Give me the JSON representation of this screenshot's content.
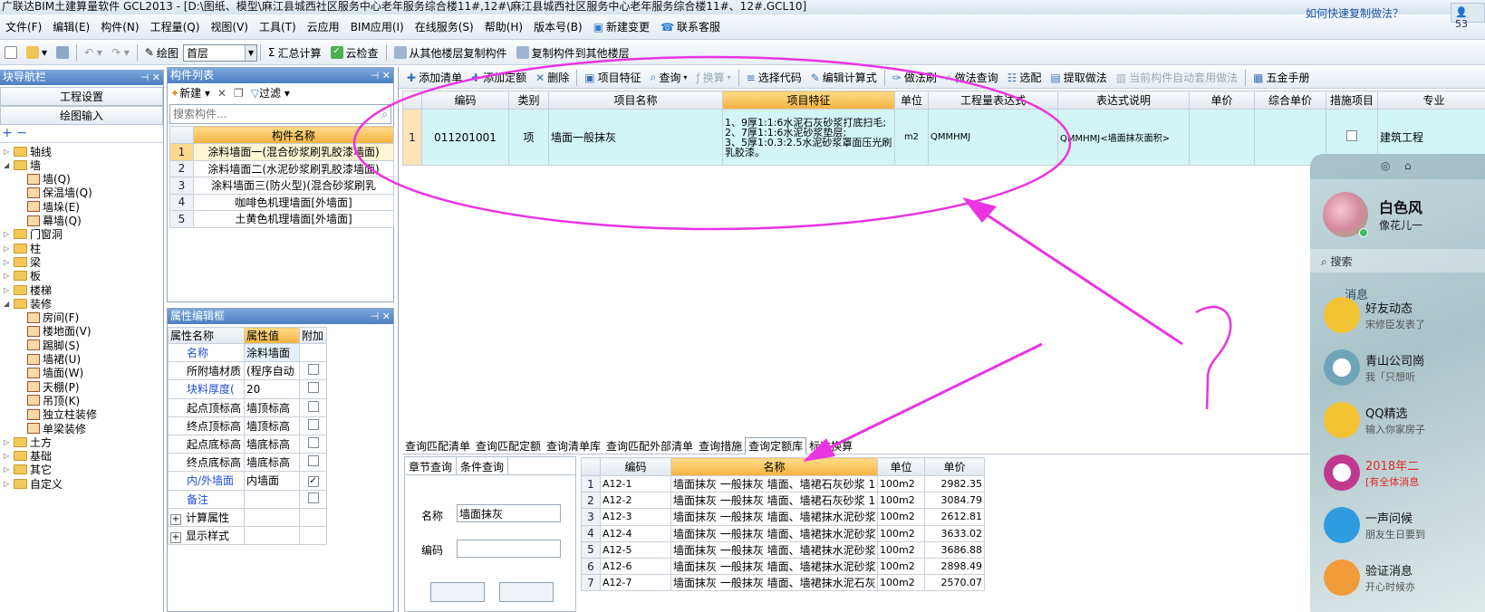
{
  "titlebar": {
    "text": "广联达BIM土建算量软件 GCL2013 - [D:\\图纸、模型\\麻江县城西社区服务中心老年服务综合楼11#,12#\\麻江县城西社区服务中心老年服务综合楼11#、12#.GCL10]"
  },
  "menubar": {
    "items": [
      "文件(F)",
      "编辑(E)",
      "构件(N)",
      "工程量(Q)",
      "视图(V)",
      "工具(T)",
      "云应用",
      "BIM应用(I)",
      "在线服务(S)",
      "帮助(H)",
      "版本号(B)"
    ],
    "new_change": "新建变更",
    "support": "联系客服",
    "help_link": "如何快速复制做法？",
    "right_badge": "53"
  },
  "toolbar": {
    "draw": "绘图",
    "floor": "首层",
    "sum": "汇总计算",
    "cloud_check": "云检查",
    "copy_from": "从其他楼层复制构件",
    "copy_to": "复制构件到其他楼层"
  },
  "nav": {
    "title": "块导航栏",
    "btn1": "工程设置",
    "btn2": "绘图输入",
    "tree": [
      {
        "label": "轴线",
        "indent": 0,
        "type": "folder",
        "exp": "▷"
      },
      {
        "label": "墙",
        "indent": 0,
        "type": "folder",
        "exp": "◢"
      },
      {
        "label": "墙(Q)",
        "indent": 1,
        "type": "leaf"
      },
      {
        "label": "保温墙(Q)",
        "indent": 1,
        "type": "leaf"
      },
      {
        "label": "墙垛(E)",
        "indent": 1,
        "type": "leaf"
      },
      {
        "label": "幕墙(Q)",
        "indent": 1,
        "type": "leaf"
      },
      {
        "label": "门窗洞",
        "indent": 0,
        "type": "folder",
        "exp": "▷"
      },
      {
        "label": "柱",
        "indent": 0,
        "type": "folder",
        "exp": "▷"
      },
      {
        "label": "梁",
        "indent": 0,
        "type": "folder",
        "exp": "▷"
      },
      {
        "label": "板",
        "indent": 0,
        "type": "folder",
        "exp": "▷"
      },
      {
        "label": "楼梯",
        "indent": 0,
        "type": "folder",
        "exp": "▷"
      },
      {
        "label": "装修",
        "indent": 0,
        "type": "folder",
        "exp": "◢"
      },
      {
        "label": "房间(F)",
        "indent": 1,
        "type": "leaf"
      },
      {
        "label": "楼地面(V)",
        "indent": 1,
        "type": "leaf"
      },
      {
        "label": "踢脚(S)",
        "indent": 1,
        "type": "leaf"
      },
      {
        "label": "墙裙(U)",
        "indent": 1,
        "type": "leaf"
      },
      {
        "label": "墙面(W)",
        "indent": 1,
        "type": "leaf"
      },
      {
        "label": "天棚(P)",
        "indent": 1,
        "type": "leaf"
      },
      {
        "label": "吊顶(K)",
        "indent": 1,
        "type": "leaf"
      },
      {
        "label": "独立柱装修",
        "indent": 1,
        "type": "leaf"
      },
      {
        "label": "单梁装修",
        "indent": 1,
        "type": "leaf"
      },
      {
        "label": "土方",
        "indent": 0,
        "type": "folder",
        "exp": "▷"
      },
      {
        "label": "基础",
        "indent": 0,
        "type": "folder",
        "exp": "▷"
      },
      {
        "label": "其它",
        "indent": 0,
        "type": "folder",
        "exp": "▷"
      },
      {
        "label": "自定义",
        "indent": 0,
        "type": "folder",
        "exp": "▷"
      }
    ]
  },
  "comp_list": {
    "title": "构件列表",
    "new": "新建",
    "filter": "过滤",
    "search_placeholder": "搜索构件...",
    "col_header": "构件名称",
    "rows": [
      "涂料墙面一(混合砂浆刷乳胶漆墙面)",
      "涂料墙面二(水泥砂浆刷乳胶漆墙面)",
      "涂料墙面三(防火型)(混合砂浆刷乳",
      "咖啡色机理墙面[外墙面]",
      "土黄色机理墙面[外墙面]"
    ]
  },
  "prop": {
    "title": "属性编辑框",
    "headers": [
      "属性名称",
      "属性值",
      "附加"
    ],
    "rows": [
      {
        "name": "名称",
        "value": "涂料墙面",
        "blue": true,
        "check": null
      },
      {
        "name": "所附墙材质",
        "value": "(程序自动",
        "blue": false,
        "check": false
      },
      {
        "name": "块料厚度(",
        "value": "20",
        "blue": true,
        "check": false
      },
      {
        "name": "起点顶标高",
        "value": "墙顶标高",
        "blue": false,
        "check": false
      },
      {
        "name": "终点顶标高",
        "value": "墙顶标高",
        "blue": false,
        "check": false
      },
      {
        "name": "起点底标高",
        "value": "墙底标高",
        "blue": false,
        "check": false
      },
      {
        "name": "终点底标高",
        "value": "墙底标高",
        "blue": false,
        "check": false
      },
      {
        "name": "内/外墙面",
        "value": "内墙面",
        "blue": true,
        "check": true
      },
      {
        "name": "备注",
        "value": "",
        "blue": true,
        "check": false
      },
      {
        "name": "计算属性",
        "value": "",
        "blue": false,
        "check": null,
        "expand": "+"
      },
      {
        "name": "显示样式",
        "value": "",
        "blue": false,
        "check": null,
        "expand": "+"
      }
    ]
  },
  "main_toolbar": {
    "items": [
      "添加清单",
      "添加定额",
      "删除",
      "项目特征",
      "查询",
      "换算",
      "选择代码",
      "编辑计算式",
      "做法刷",
      "做法查询",
      "选配",
      "提取做法",
      "当前构件自动套用做法",
      "五金手册"
    ]
  },
  "main_grid": {
    "headers": [
      "编码",
      "类别",
      "项目名称",
      "项目特征",
      "单位",
      "工程量表达式",
      "表达式说明",
      "单价",
      "综合单价",
      "措施项目",
      "专业"
    ],
    "row": {
      "num": "1",
      "code": "011201001",
      "type": "项",
      "name": "墙面一般抹灰",
      "feature": "1、9厚1:1:6水泥石灰砂浆打底扫毛;\n2、7厚1:1:6水泥砂浆垫层;\n3、5厚1:0.3:2.5水泥砂浆罩面压光刷乳胶漆。",
      "unit": "m2",
      "expr": "QMMHMJ",
      "expr_desc": "QMMHMJ<墙面抹灰面积>",
      "price": "",
      "comp_price": "",
      "measure": false,
      "major": "建筑工程"
    }
  },
  "bottom": {
    "tabs": [
      "查询匹配清单",
      "查询匹配定额",
      "查询清单库",
      "查询匹配外部清单",
      "查询措施",
      "查询定额库",
      "标准换算"
    ],
    "active_tab": 5,
    "sub_tabs": [
      "章节查询",
      "条件查询"
    ],
    "name_label": "名称",
    "name_value": "墙面抹灰",
    "code_label": "编码",
    "code_value": "",
    "grid_headers": [
      "编码",
      "名称",
      "单位",
      "单价"
    ],
    "rows": [
      {
        "n": "1",
        "code": "A12-1",
        "name": "墙面抹灰 一般抹灰 墙面、墙裙石灰砂浆 1",
        "unit": "100m2",
        "price": "2982.35"
      },
      {
        "n": "2",
        "code": "A12-2",
        "name": "墙面抹灰 一般抹灰 墙面、墙裙石灰砂浆 1",
        "unit": "100m2",
        "price": "3084.79"
      },
      {
        "n": "3",
        "code": "A12-3",
        "name": "墙面抹灰 一般抹灰 墙面、墙裙抹水泥砂浆",
        "unit": "100m2",
        "price": "2612.81"
      },
      {
        "n": "4",
        "code": "A12-4",
        "name": "墙面抹灰 一般抹灰 墙面、墙裙抹水泥砂浆",
        "unit": "100m2",
        "price": "3633.02"
      },
      {
        "n": "5",
        "code": "A12-5",
        "name": "墙面抹灰 一般抹灰 墙面、墙裙抹水泥砂浆",
        "unit": "100m2",
        "price": "3686.88"
      },
      {
        "n": "6",
        "code": "A12-6",
        "name": "墙面抹灰 一般抹灰 墙面、墙裙抹水泥砂浆",
        "unit": "100m2",
        "price": "2898.49"
      },
      {
        "n": "7",
        "code": "A12-7",
        "name": "墙面抹灰 一般抹灰 墙面、墙裙抹水泥石灰",
        "unit": "100m2",
        "price": "2570.07"
      }
    ]
  },
  "qq": {
    "name": "白色风",
    "sign": "像花儿一",
    "search": "搜索",
    "tab": "消息",
    "items": [
      {
        "t1": "好友动态",
        "t2": "宋修臣发表了",
        "c": "#f1c232",
        "r": "#fff"
      },
      {
        "t1": "青山公司崗",
        "t2": "我「只想听",
        "c": "#6fa6b7",
        "r": "#fff"
      },
      {
        "t1": "QQ精选",
        "t2": "输入你家房子",
        "c": "#f3c233",
        "r": "#fff"
      },
      {
        "t1": "2018年二",
        "t2": "[有全体消息",
        "c": "#c0398f",
        "r": "#fff"
      },
      {
        "t1": "一声问候",
        "t2": "朋友生日要到",
        "c": "#2e9be0",
        "r": "#fff"
      },
      {
        "t1": "验证消息",
        "t2": "开心时候亦",
        "c": "#f29b3b",
        "r": "#fff"
      }
    ]
  },
  "annotation": {
    "color": "#ea33e2",
    "mark": "?"
  }
}
